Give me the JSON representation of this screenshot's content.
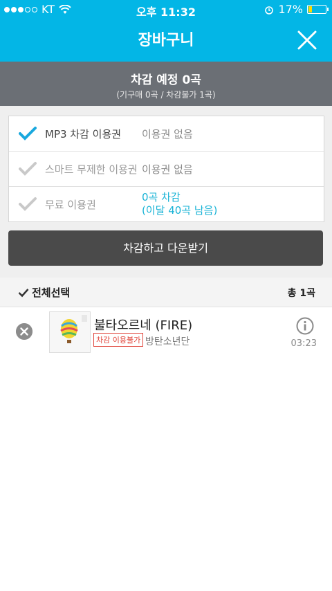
{
  "status_bar": {
    "carrier": "KT",
    "time": "오후 11:32",
    "battery": "17%",
    "battery_level": 0.17
  },
  "header": {
    "title": "장바구니",
    "close_icon": "close-icon"
  },
  "summary": {
    "main": "차감 예정 0곡",
    "sub": "(기구매 0곡 / 차감불가 1곡)"
  },
  "vouchers": [
    {
      "label": "MP3 차감 이용권",
      "value": "이용권 없음",
      "checked": true
    },
    {
      "label": "스마트 무제한 이용권",
      "value": "이용권 없음",
      "checked": false
    },
    {
      "label": "무료 이용권",
      "value_line1": "0곡 차감",
      "value_line2": "(이달 40곡 남음)",
      "checked": false
    }
  ],
  "download_button": "차감하고 다운받기",
  "select_bar": {
    "select_all": "전체선택",
    "count": "총 1곡"
  },
  "songs": [
    {
      "title": "불타오르네 (FIRE)",
      "badge": "차감 이용불가",
      "artist": "방탄소년단",
      "duration": "03:23"
    }
  ],
  "colors": {
    "accent": "#03b6e6",
    "summary_bg": "#6b6f75",
    "button_bg": "#4a4a4a",
    "badge_red": "#e0453b",
    "value_accent": "#18b3d6"
  }
}
